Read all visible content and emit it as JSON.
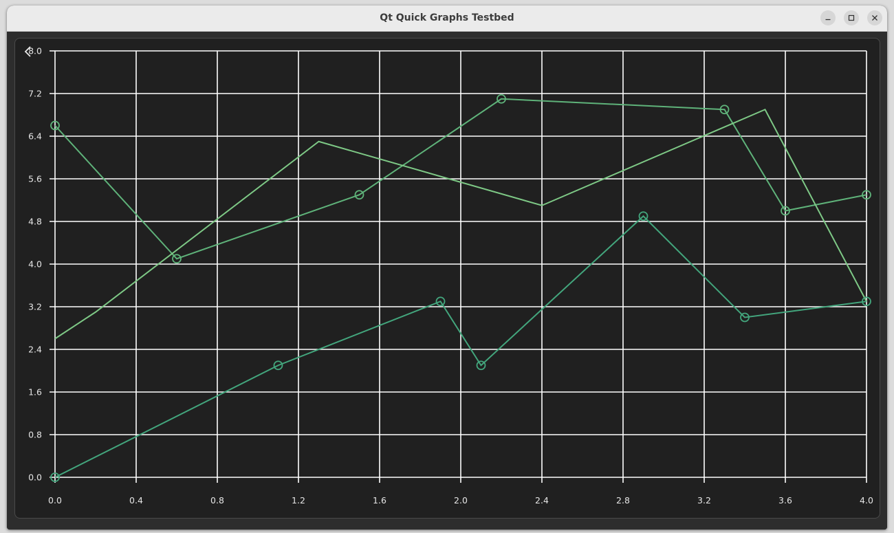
{
  "window": {
    "title": "Qt Quick Graphs Testbed"
  },
  "icons": {
    "back": "chevron-left-icon",
    "minimize": "minimize-icon",
    "maximize": "maximize-icon",
    "close": "close-icon"
  },
  "colors": {
    "background": "#202020",
    "grid": "#ffffff",
    "series_a": "#5fb37a",
    "series_b": "#7ec986",
    "series_c": "#43a67d"
  },
  "chart_data": {
    "type": "line",
    "title": "",
    "xlabel": "",
    "ylabel": "",
    "xlim": [
      0.0,
      4.0
    ],
    "ylim": [
      0.0,
      8.0
    ],
    "grid": true,
    "x_ticks": [
      "0.0",
      "0.4",
      "0.8",
      "1.2",
      "1.6",
      "2.0",
      "2.4",
      "2.8",
      "3.2",
      "3.6",
      "4.0"
    ],
    "y_ticks": [
      "0.0",
      "0.8",
      "1.6",
      "2.4",
      "3.2",
      "4.0",
      "4.8",
      "5.6",
      "6.4",
      "7.2",
      "8.0"
    ],
    "series": [
      {
        "markers": true,
        "color": "#5fb37a",
        "x": [
          0.0,
          0.6,
          1.5,
          2.2,
          3.3,
          3.6,
          4.0
        ],
        "y": [
          6.6,
          4.1,
          5.3,
          7.1,
          6.9,
          5.0,
          5.3
        ]
      },
      {
        "markers": false,
        "color": "#7ec986",
        "x": [
          0.0,
          0.2,
          1.3,
          2.4,
          3.5,
          4.0
        ],
        "y": [
          2.6,
          3.1,
          6.3,
          5.1,
          6.9,
          3.3
        ]
      },
      {
        "markers": true,
        "color": "#43a67d",
        "x": [
          0.0,
          1.1,
          1.9,
          2.1,
          2.9,
          3.4,
          4.0
        ],
        "y": [
          0.0,
          2.1,
          3.3,
          2.1,
          4.9,
          3.0,
          3.3
        ]
      }
    ]
  }
}
